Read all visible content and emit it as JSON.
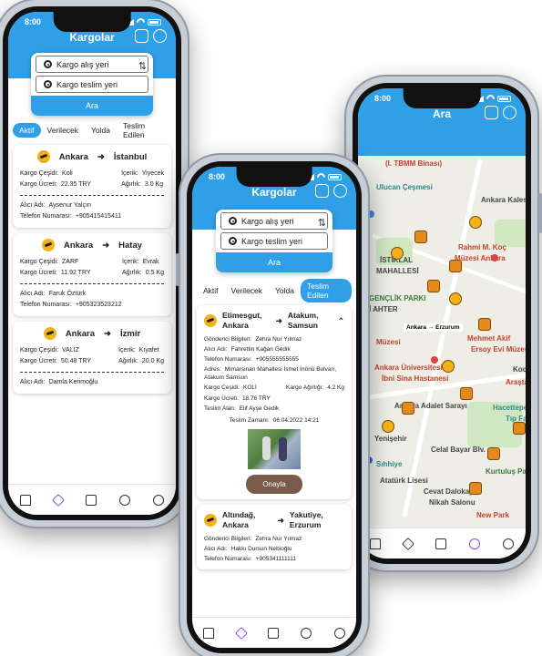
{
  "status_time": "8:00",
  "phone1": {
    "title": "Kargolar",
    "search": {
      "from_placeholder": "Kargo alış yeri",
      "to_placeholder": "Kargo teslim yeri",
      "button": "Ara"
    },
    "tabs": [
      {
        "label": "Aktif",
        "active": true
      },
      {
        "label": "Verilecek"
      },
      {
        "label": "Yolda"
      },
      {
        "label": "Teslim Edilen"
      }
    ],
    "cards": [
      {
        "from": "Ankara",
        "to": "İstanbul",
        "type_label": "Kargo Çeşidi:",
        "type": "Koli",
        "fee_label": "Kargo Ücreti:",
        "fee": "22.35 TRY",
        "content_label": "İçerik:",
        "content": "Yiyecek",
        "weight_label": "Ağırlık:",
        "weight": "3.0 Kg",
        "receiver_label": "Alıcı Adı:",
        "receiver": "Aysenur Yalçın",
        "phone_label": "Telefon Numarası:",
        "phone": "+905415415411"
      },
      {
        "from": "Ankara",
        "to": "Hatay",
        "type_label": "Kargo Çeşidi:",
        "type": "ZARF",
        "fee_label": "Kargo Ücreti:",
        "fee": "11.92 TRY",
        "content_label": "İçerik:",
        "content": "Evrak",
        "weight_label": "Ağırlık:",
        "weight": "0.5 Kg",
        "receiver_label": "Alıcı Adı:",
        "receiver": "Faruk Öztürk",
        "phone_label": "Telefon Numarası:",
        "phone": "+905323523212"
      },
      {
        "from": "Ankara",
        "to": "İzmir",
        "type_label": "Kargo Çeşidi:",
        "type": "VALİZ",
        "fee_label": "Kargo Ücreti:",
        "fee": "50.48 TRY",
        "content_label": "İçerik:",
        "content": "Kıyafet",
        "weight_label": "Ağırlık:",
        "weight": "20.0 Kg",
        "receiver_label": "Alıcı Adı:",
        "receiver": "Damla Kerimoğlu"
      }
    ]
  },
  "phone2": {
    "title": "Kargolar",
    "search": {
      "from_placeholder": "Kargo alış yeri",
      "to_placeholder": "Kargo teslim yeri",
      "button": "Ara"
    },
    "tabs": [
      {
        "label": "Aktif"
      },
      {
        "label": "Verilecek"
      },
      {
        "label": "Yolda"
      },
      {
        "label": "Teslim Edilen",
        "active": true
      }
    ],
    "delivered": {
      "from": "Etimesgut, Ankara",
      "to": "Atakum, Samsun",
      "sender_label": "Gönderici Bilgileri:",
      "sender": "Zehra Nur Yılmaz",
      "receiver_label": "Alıcı Adı:",
      "receiver": "Fahrettin Kağan Gedik",
      "phone_label": "Telefon Numarası:",
      "phone": "+905555555555",
      "address_label": "Adres:",
      "address": "Mimarsinan Mahallesi İsmet İnönü Bulvarı, Atakum Samsun",
      "type_label": "Kargo Çeşidi:",
      "type": "KOLİ",
      "weight_label": "Kargo Ağırlığı:",
      "weight": "4.2 Kg",
      "fee_label": "Kargo Ücreti:",
      "fee": "18.76 TRY",
      "delivered_to_label": "Teslim Alan:",
      "delivered_to": "Elif Ayşe Gedik",
      "delivery_time_label": "Teslim Zamanı:",
      "delivery_time": "06.04.2022 14:21",
      "approve": "Onayla"
    },
    "second": {
      "from": "Altındağ, Ankara",
      "to": "Yakutiye, Erzurum",
      "sender_label": "Gönderici Bilgileri:",
      "sender": "Zehra Nur Yılmaz",
      "receiver_label": "Alıcı Adı:",
      "receiver": "Hakkı Dursun Nebioğlu",
      "phone_label": "Telefon Numarası:",
      "phone": "+905341111111"
    }
  },
  "phone3": {
    "title": "Ara",
    "route_label": "Ankara → Erzurum",
    "map_labels": {
      "tbmm": "(I. TBMM Binası)",
      "ulucan": "Ulucan Çeşmesi",
      "kalesi": "Ankara Kalesi",
      "istiklal": "İSTİKLAL",
      "mahallesi": "MAHALLESİ",
      "koc": "Rahmi M. Koç",
      "koc2": "Müzesi Ankara",
      "genclik": "GENÇLİK PARKI",
      "ahter": "İRİ AHTER",
      "museum": "Müzesi",
      "akif": "Mehmet Akif",
      "ersoy": "Ersoy Evi Müzesi",
      "univ": "Ankara Üniversitesi",
      "sina": "İbni Sina Hastanesi",
      "adalet": "Ankara Adalet Sarayı",
      "hacettepe": "Hacettepe",
      "yenisehir": "Yenişehir",
      "bulvar": "Celal Bayar Blv.",
      "sihhiye": "Sıhhiye",
      "ataturk": "Atatürk Lisesi",
      "dalokay": "Cevat Dalokay",
      "nikah": "Nikah Salonu",
      "kurtulus": "Kurtuluş Pa",
      "newpark": "New Park",
      "arasta": "Araşta",
      "kocagil": "Kocagil",
      "tip": "Tıp Fakül"
    }
  },
  "tabbar": [
    "home-icon",
    "package-icon",
    "briefcase-icon",
    "upload-icon",
    "profile-icon"
  ]
}
